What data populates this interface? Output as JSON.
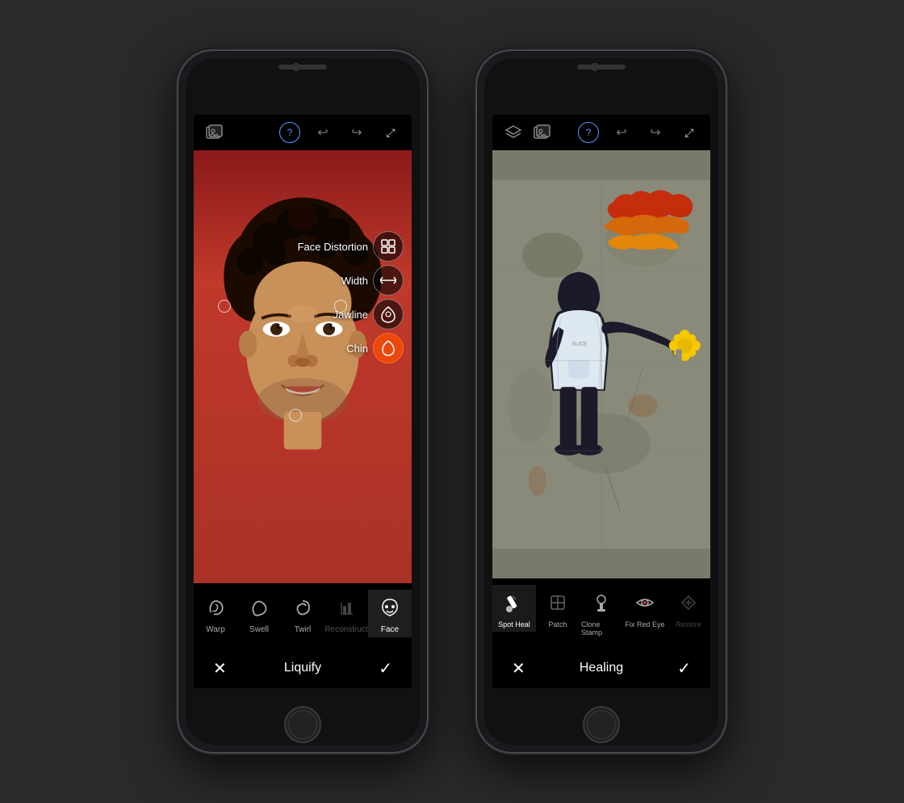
{
  "phone1": {
    "toolbar": {
      "undo_label": "↩",
      "redo_label": "↪",
      "expand_label": "⤢",
      "help_label": "?",
      "photo_icon": "🖼"
    },
    "face_menu": [
      {
        "id": "face-distortion",
        "label": "Face Distortion",
        "icon": "⊞",
        "active": false
      },
      {
        "id": "width",
        "label": "Width",
        "icon": "↔",
        "active": false
      },
      {
        "id": "jawline",
        "label": "Jawline",
        "icon": "◎",
        "active": false
      },
      {
        "id": "chin",
        "label": "Chin",
        "icon": "○",
        "active": true
      }
    ],
    "tools": [
      {
        "id": "warp",
        "label": "Warp",
        "active": false,
        "disabled": false
      },
      {
        "id": "swell",
        "label": "Swell",
        "active": false,
        "disabled": false
      },
      {
        "id": "twirl",
        "label": "Twirl",
        "active": false,
        "disabled": false
      },
      {
        "id": "reconstruct",
        "label": "Reconstruct",
        "active": false,
        "disabled": true
      },
      {
        "id": "face",
        "label": "Face",
        "active": true,
        "disabled": false
      }
    ],
    "action_bar": {
      "cancel": "✕",
      "title": "Liquify",
      "confirm": "✓"
    }
  },
  "phone2": {
    "toolbar": {
      "layers_label": "⧉",
      "photo_icon": "🖼",
      "help_label": "?",
      "undo_label": "↩",
      "redo_label": "↪",
      "expand_label": "⤢"
    },
    "tools": [
      {
        "id": "spot-heal",
        "label": "Spot Heal",
        "active": true,
        "disabled": false
      },
      {
        "id": "patch",
        "label": "Patch",
        "active": false,
        "disabled": false
      },
      {
        "id": "clone-stamp",
        "label": "Clone Stamp",
        "active": false,
        "disabled": false
      },
      {
        "id": "fix-red-eye",
        "label": "Fix Red Eye",
        "active": false,
        "disabled": false
      },
      {
        "id": "restore",
        "label": "Restore",
        "active": false,
        "disabled": false
      }
    ],
    "action_bar": {
      "cancel": "✕",
      "title": "Healing",
      "confirm": "✓"
    }
  }
}
